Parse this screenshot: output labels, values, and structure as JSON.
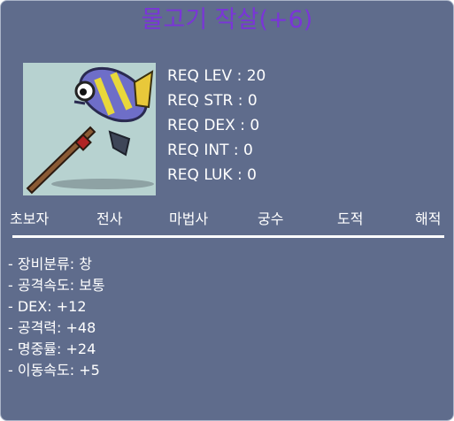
{
  "item": {
    "name": "물고기 작살(+6)",
    "image_icon": "fish-spear-icon"
  },
  "requirements": [
    "REQ LEV : 20",
    "REQ STR : 0",
    "REQ DEX : 0",
    "REQ INT : 0",
    "REQ LUK : 0"
  ],
  "jobs": [
    "초보자",
    "전사",
    "마법사",
    "궁수",
    "도적",
    "해적"
  ],
  "stats": [
    "- 장비분류: 창",
    "- 공격속도: 보통",
    "- DEX: +12",
    "- 공격력: +48",
    "- 명중률: +24",
    "- 이동속도: +5"
  ],
  "colors": {
    "background": "#5f6c8c",
    "title": "#7a35d8",
    "text": "#ffffff",
    "image_background": "#b7d2d0"
  }
}
